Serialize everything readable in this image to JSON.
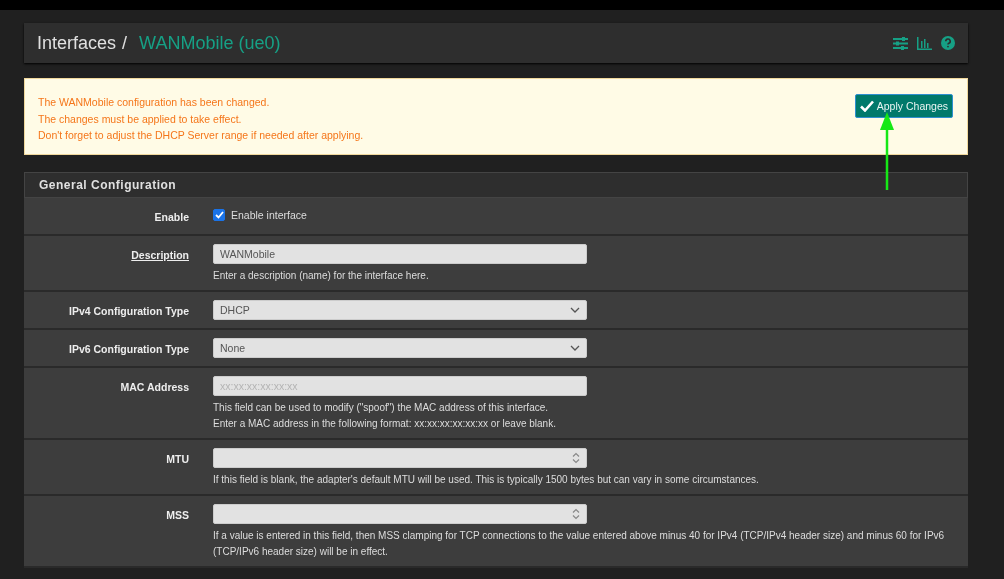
{
  "header": {
    "section": "Interfaces",
    "separator": "/",
    "title": "WANMobile (ue0)"
  },
  "alert": {
    "lines": [
      "The WANMobile configuration has been changed.",
      "The changes must be applied to take effect.",
      "Don't forget to adjust the DHCP Server range if needed after applying."
    ],
    "button": "Apply Changes"
  },
  "panel": {
    "title": "General Configuration",
    "rows": [
      {
        "kind": "checkbox",
        "label": "Enable",
        "link": false,
        "checked": true,
        "text": "Enable interface"
      },
      {
        "kind": "text",
        "label": "Description",
        "link": true,
        "value": "WANMobile",
        "help": [
          "Enter a description (name) for the interface here."
        ]
      },
      {
        "kind": "select",
        "label": "IPv4 Configuration Type",
        "link": false,
        "value": "DHCP"
      },
      {
        "kind": "select",
        "label": "IPv6 Configuration Type",
        "link": false,
        "value": "None"
      },
      {
        "kind": "text",
        "label": "MAC Address",
        "link": false,
        "placeholder": "xx:xx:xx:xx:xx:xx",
        "help": [
          "This field can be used to modify (\"spoof\") the MAC address of this interface.",
          "Enter a MAC address in the following format: xx:xx:xx:xx:xx:xx or leave blank."
        ]
      },
      {
        "kind": "number",
        "label": "MTU",
        "link": false,
        "help": [
          "If this field is blank, the adapter's default MTU will be used. This is typically 1500 bytes but can vary in some circumstances."
        ]
      },
      {
        "kind": "number",
        "label": "MSS",
        "link": false,
        "help": [
          "If a value is entered in this field, then MSS clamping for TCP connections to the value entered above minus 40 for IPv4 (TCP/IPv4 header size) and minus 60 for IPv6 (TCP/IPv6 header size) will be in effect."
        ]
      }
    ]
  }
}
